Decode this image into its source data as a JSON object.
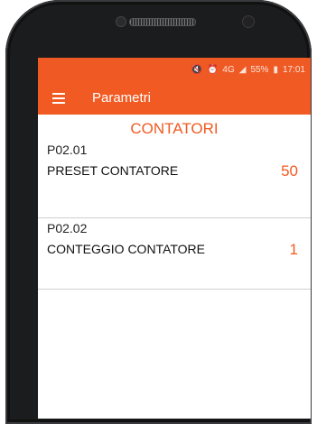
{
  "status_bar": {
    "icons": [
      "mute-icon",
      "alarm-icon",
      "signal-icon"
    ],
    "network": "4G",
    "battery": "55%",
    "time": "17:01"
  },
  "app_bar": {
    "title": "Parametri"
  },
  "section": {
    "title": "CONTATORI"
  },
  "parameters": [
    {
      "code": "P02.01",
      "name": "PRESET CONTATORE",
      "value": "50"
    },
    {
      "code": "P02.02",
      "name": "CONTEGGIO CONTATORE",
      "value": "1"
    }
  ],
  "colors": {
    "accent": "#f15a22",
    "phone_body": "#1b1c1e"
  }
}
